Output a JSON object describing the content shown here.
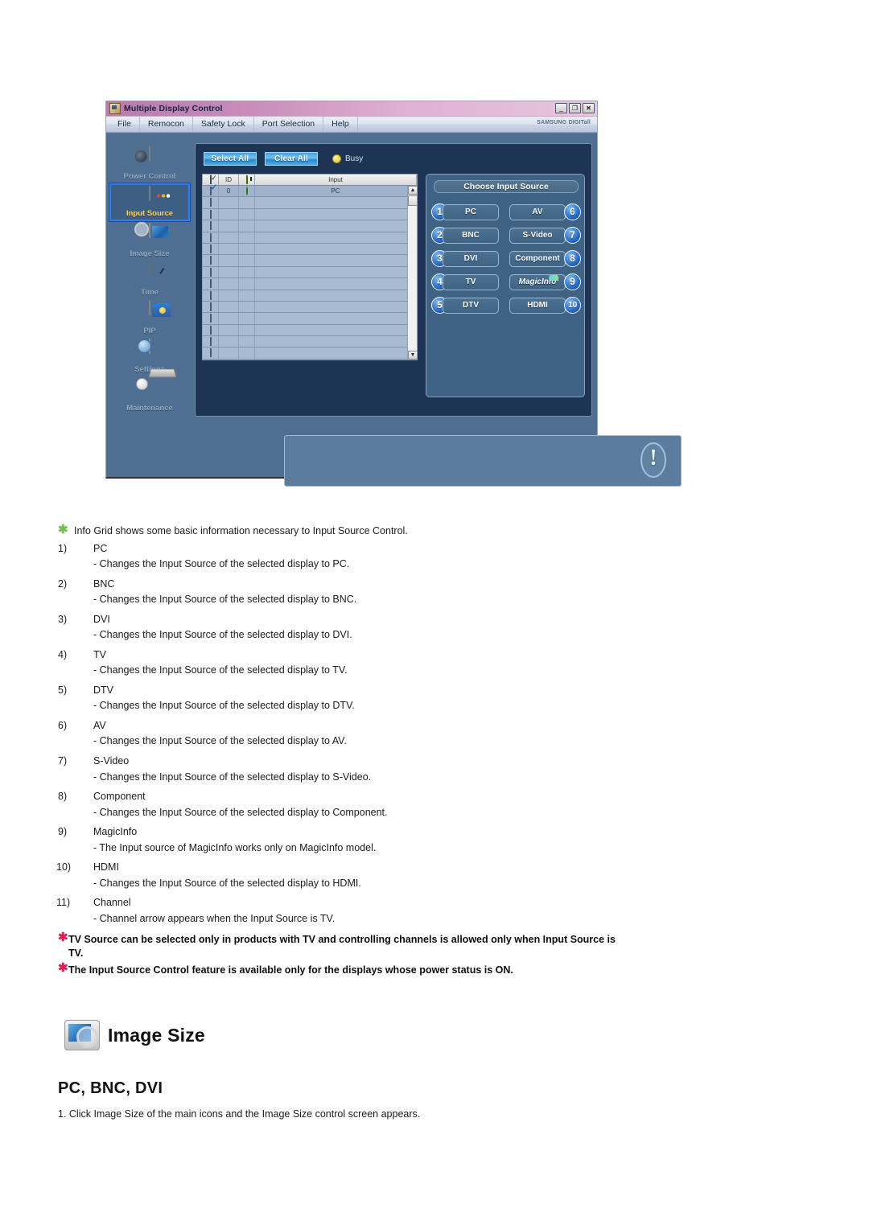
{
  "app": {
    "window_title": "Multiple Display Control",
    "brand": "SAMSUNG DIGITall",
    "window_buttons": {
      "minimize": "_",
      "maximize": "❐",
      "close": "✕"
    },
    "menu": [
      "File",
      "Remocon",
      "Safety Lock",
      "Port Selection",
      "Help"
    ],
    "toolbar": {
      "select_all": "Select All",
      "clear_all": "Clear All",
      "busy_label": "Busy"
    },
    "sidebar": [
      {
        "label": "Power Control",
        "icon": "power-control-icon",
        "active": false
      },
      {
        "label": "Input Source",
        "icon": "input-source-icon",
        "active": true
      },
      {
        "label": "Image Size",
        "icon": "image-size-icon",
        "active": false
      },
      {
        "label": "Time",
        "icon": "time-icon",
        "active": false
      },
      {
        "label": "PIP",
        "icon": "pip-icon",
        "active": false
      },
      {
        "label": "Settings",
        "icon": "settings-icon",
        "active": false
      },
      {
        "label": "Maintenance",
        "icon": "maintenance-icon",
        "active": false
      }
    ],
    "grid": {
      "headers": [
        "",
        "ID",
        "",
        "Input"
      ],
      "rows": [
        {
          "checked": true,
          "id": "0",
          "power": "on",
          "input": "PC"
        },
        {
          "checked": false,
          "id": "",
          "power": "",
          "input": ""
        },
        {
          "checked": false,
          "id": "",
          "power": "",
          "input": ""
        },
        {
          "checked": false,
          "id": "",
          "power": "",
          "input": ""
        },
        {
          "checked": false,
          "id": "",
          "power": "",
          "input": ""
        },
        {
          "checked": false,
          "id": "",
          "power": "",
          "input": ""
        },
        {
          "checked": false,
          "id": "",
          "power": "",
          "input": ""
        },
        {
          "checked": false,
          "id": "",
          "power": "",
          "input": ""
        },
        {
          "checked": false,
          "id": "",
          "power": "",
          "input": ""
        },
        {
          "checked": false,
          "id": "",
          "power": "",
          "input": ""
        },
        {
          "checked": false,
          "id": "",
          "power": "",
          "input": ""
        },
        {
          "checked": false,
          "id": "",
          "power": "",
          "input": ""
        },
        {
          "checked": false,
          "id": "",
          "power": "",
          "input": ""
        },
        {
          "checked": false,
          "id": "",
          "power": "",
          "input": ""
        },
        {
          "checked": false,
          "id": "",
          "power": "",
          "input": ""
        }
      ]
    },
    "source_panel": {
      "title": "Choose Input Source",
      "buttons": [
        {
          "badge": "1",
          "label": "PC"
        },
        {
          "badge": "6",
          "label": "AV"
        },
        {
          "badge": "2",
          "label": "BNC"
        },
        {
          "badge": "7",
          "label": "S-Video"
        },
        {
          "badge": "3",
          "label": "DVI"
        },
        {
          "badge": "8",
          "label": "Component"
        },
        {
          "badge": "4",
          "label": "TV"
        },
        {
          "badge": "9",
          "label": "MagicInfo"
        },
        {
          "badge": "5",
          "label": "DTV"
        },
        {
          "badge": "10",
          "label": "HDMI"
        }
      ]
    }
  },
  "doc": {
    "intro_note": "Info Grid shows some basic information necessary to Input Source Control.",
    "items": [
      {
        "num": "1)",
        "term": "PC",
        "desc": "- Changes the Input Source of the selected display to PC."
      },
      {
        "num": "2)",
        "term": "BNC",
        "desc": "- Changes the Input Source of the selected display to BNC."
      },
      {
        "num": "3)",
        "term": "DVI",
        "desc": "- Changes the Input Source of the selected display to DVI."
      },
      {
        "num": "4)",
        "term": "TV",
        "desc": "- Changes the Input Source of the selected display to TV."
      },
      {
        "num": "5)",
        "term": "DTV",
        "desc": "- Changes the Input Source of the selected display to DTV."
      },
      {
        "num": "6)",
        "term": "AV",
        "desc": "- Changes the Input Source of the selected display to AV."
      },
      {
        "num": "7)",
        "term": "S-Video",
        "desc": "- Changes the Input Source of the selected display to S-Video."
      },
      {
        "num": "8)",
        "term": "Component",
        "desc": "- Changes the Input Source of the selected display to Component."
      },
      {
        "num": "9)",
        "term": "MagicInfo",
        "desc": "- The Input source of MagicInfo works only on MagicInfo model."
      },
      {
        "num": "10)",
        "term": "HDMI",
        "desc": "- Changes the Input Source of the selected display to HDMI."
      },
      {
        "num": "11)",
        "term": "Channel",
        "desc": "- Channel arrow appears when the Input Source is TV."
      }
    ],
    "bold_notes": [
      "TV Source can be selected only in products with TV and controlling channels is allowed only when Input Source is TV.",
      "The Input Source Control feature is available only for the displays whose power status is ON."
    ],
    "section_title": "Image Size",
    "sub_title": "PC, BNC, DVI",
    "step_1": "1.  Click Image Size of the main icons and the Image Size control screen appears."
  },
  "colors": {
    "titlebar_pink": "#c98cbb",
    "app_body": "#4e6f92",
    "panel_navy": "#1e3454",
    "accent_blue": "#1a5fc0",
    "active_yellow": "#ffd84a",
    "green_asterisk": "#6ec14a",
    "red_asterisk": "#e8194b",
    "busy_yellow": "#d9c82c",
    "led_green": "#1faa12"
  }
}
